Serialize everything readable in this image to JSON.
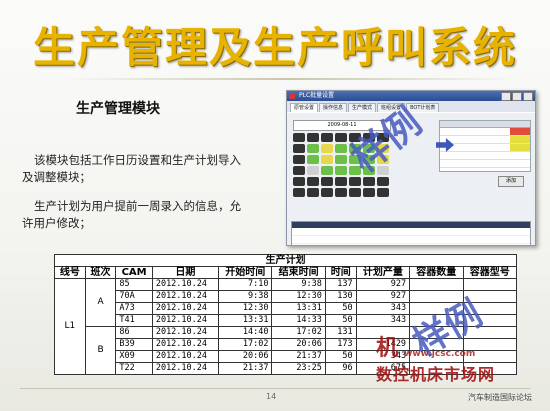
{
  "slide": {
    "title": "生产管理及生产呼叫系统",
    "subtitle": "生产管理模块",
    "paragraph1": "该模块包括工作日历设置和生产计划导入及调整模块；",
    "paragraph2": "生产计划为用户提前一周录入的信息，允许用户修改；",
    "page_number": "14",
    "footer": "汽车制造国际论坛"
  },
  "screenshot": {
    "window_title": "PLC批量设置",
    "tabs": [
      "原管设置",
      "操作信息",
      "生产模式",
      "班组设置",
      "BOT计划表"
    ],
    "date_field": "2009-08-11",
    "button": "添加"
  },
  "table": {
    "caption": "生产计划",
    "headers": [
      "线号",
      "班次",
      "CAM",
      "日期",
      "开始时间",
      "结束时间",
      "时间",
      "计划产量",
      "容器数量",
      "容器型号"
    ],
    "line": "L1",
    "groups": [
      {
        "shift": "A",
        "rows": [
          [
            "85",
            "2012.10.24",
            "7:10",
            "9:38",
            "137",
            "927",
            "",
            ""
          ],
          [
            "70A",
            "2012.10.24",
            "9:38",
            "12:30",
            "130",
            "927",
            "",
            ""
          ],
          [
            "A73",
            "2012.10.24",
            "12:30",
            "13:31",
            "50",
            "343",
            "",
            ""
          ],
          [
            "T41",
            "2012.10.24",
            "13:31",
            "14:33",
            "50",
            "343",
            "",
            ""
          ]
        ]
      },
      {
        "shift": "B",
        "rows": [
          [
            "86",
            "2012.10.24",
            "14:40",
            "17:02",
            "131",
            "",
            "",
            ""
          ],
          [
            "B39",
            "2012.10.24",
            "17:02",
            "20:06",
            "173",
            "1429",
            "",
            ""
          ],
          [
            "X09",
            "2012.10.24",
            "20:06",
            "21:37",
            "50",
            "343",
            "",
            ""
          ],
          [
            "T22",
            "2012.10.24",
            "21:37",
            "23:25",
            "96",
            "675",
            "",
            ""
          ]
        ]
      }
    ]
  },
  "watermark": {
    "mark1": "样例",
    "mark2": "样例",
    "brand": "机",
    "site": "www.jcsc.com",
    "market": "数控机床市场网"
  },
  "colors": {
    "title": "#e8b300",
    "watermark": "#4660be"
  }
}
